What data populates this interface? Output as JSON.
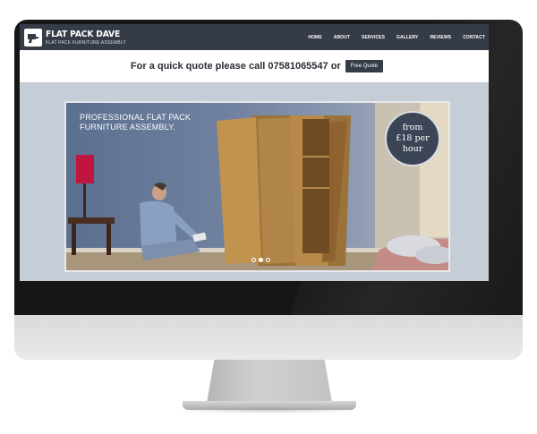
{
  "site": {
    "logo_title": "FLAT PACK DAVE",
    "logo_tagline": "FLAT PACK FURNITURE ASSEMBLY",
    "nav": [
      "HOME",
      "ABOUT",
      "SERVICES",
      "GALLERY",
      "REVIEWS",
      "CONTACT"
    ]
  },
  "quote_bar": {
    "text": "For a quick quote please call 07581065547 or",
    "button_label": "Free Quote"
  },
  "hero": {
    "title_line1": "PROFESSIONAL FLAT PACK",
    "title_line2": "FURNITURE ASSEMBLY.",
    "badge_line1": "from",
    "badge_line2": "£18 per",
    "badge_line3": "hour",
    "slide_count": 3,
    "active_slide": 1
  },
  "colors": {
    "header_bg": "#353c48",
    "page_bg": "#c5cdd6",
    "accent_white": "#ffffff"
  }
}
